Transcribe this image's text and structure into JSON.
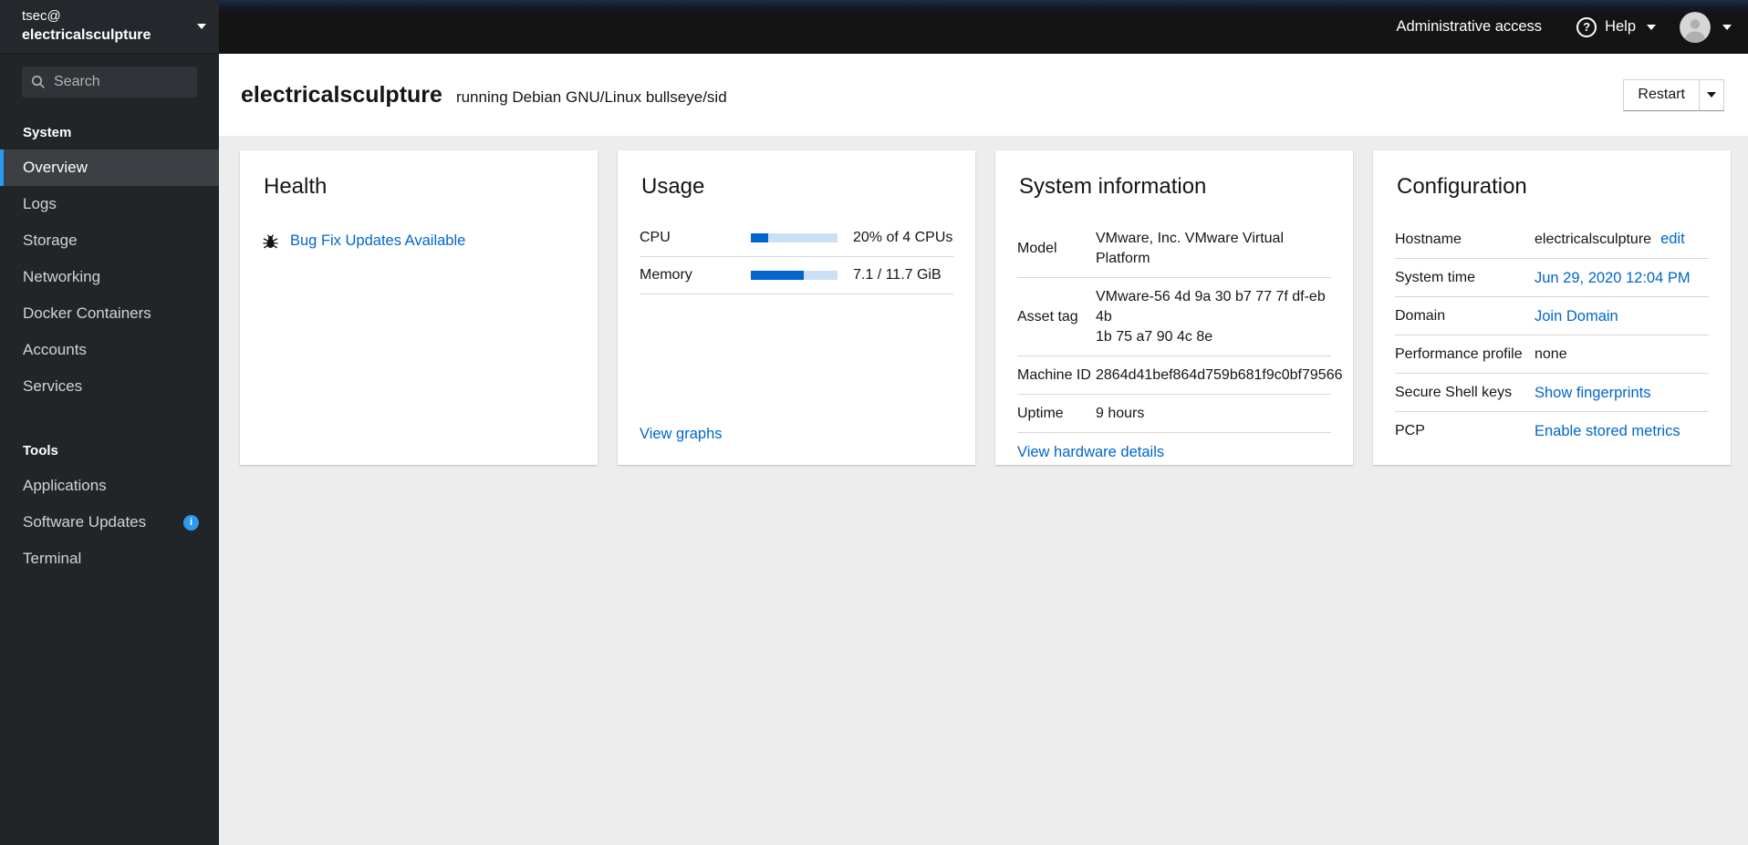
{
  "colors": {
    "link_blue": "#0066cc",
    "progress_fill": "#0066cc",
    "progress_track": "#cce0f5",
    "nav_active_accent": "#2b9af3",
    "info_badge_blue": "#2b9af3",
    "masthead_bg": "#141414",
    "sidebar_bg": "#222528",
    "page_bg": "#ededed"
  },
  "icons": {
    "help_glyph": "?"
  },
  "masthead": {
    "administrative_access": "Administrative access",
    "help": "Help"
  },
  "sidebar": {
    "user": "tsec@",
    "host": "electricalsculpture",
    "search_placeholder": "Search",
    "sections": [
      {
        "title": "System",
        "items": [
          {
            "label": "Overview",
            "active": true
          },
          {
            "label": "Logs"
          },
          {
            "label": "Storage"
          },
          {
            "label": "Networking"
          },
          {
            "label": "Docker Containers"
          },
          {
            "label": "Accounts"
          },
          {
            "label": "Services"
          }
        ]
      },
      {
        "title": "Tools",
        "items": [
          {
            "label": "Applications"
          },
          {
            "label": "Software Updates",
            "badge": "i"
          },
          {
            "label": "Terminal"
          }
        ]
      }
    ]
  },
  "header": {
    "hostname": "electricalsculpture",
    "os_text": "running Debian GNU/Linux bullseye/sid",
    "restart": "Restart"
  },
  "cards": {
    "health": {
      "title": "Health",
      "update_link": "Bug Fix Updates Available"
    },
    "usage": {
      "title": "Usage",
      "rows": [
        {
          "label": "CPU",
          "percent": 20,
          "value": "20% of 4 CPUs"
        },
        {
          "label": "Memory",
          "percent": 61,
          "value": "7.1 / 11.7 GiB"
        }
      ],
      "view_graphs": "View graphs"
    },
    "system_info": {
      "title": "System information",
      "rows": [
        {
          "label": "Model",
          "value": "VMware, Inc. VMware Virtual Platform"
        },
        {
          "label": "Asset tag",
          "value": "VMware-56 4d 9a 30 b7 77 7f df-eb 4b\n1b 75 a7 90 4c 8e"
        },
        {
          "label": "Machine ID",
          "value": "2864d41bef864d759b681f9c0bf79566"
        },
        {
          "label": "Uptime",
          "value": "9 hours"
        }
      ],
      "view_hardware": "View hardware details"
    },
    "configuration": {
      "title": "Configuration",
      "rows": {
        "hostname": {
          "label": "Hostname",
          "value": "electricalsculpture",
          "edit": "edit"
        },
        "system_time": {
          "label": "System time",
          "link": "Jun 29, 2020 12:04 PM"
        },
        "domain": {
          "label": "Domain",
          "link": "Join Domain"
        },
        "performance": {
          "label": "Performance profile",
          "value": "none"
        },
        "ssh": {
          "label": "Secure Shell keys",
          "link": "Show fingerprints"
        },
        "pcp": {
          "label": "PCP",
          "link": "Enable stored metrics"
        }
      }
    }
  }
}
